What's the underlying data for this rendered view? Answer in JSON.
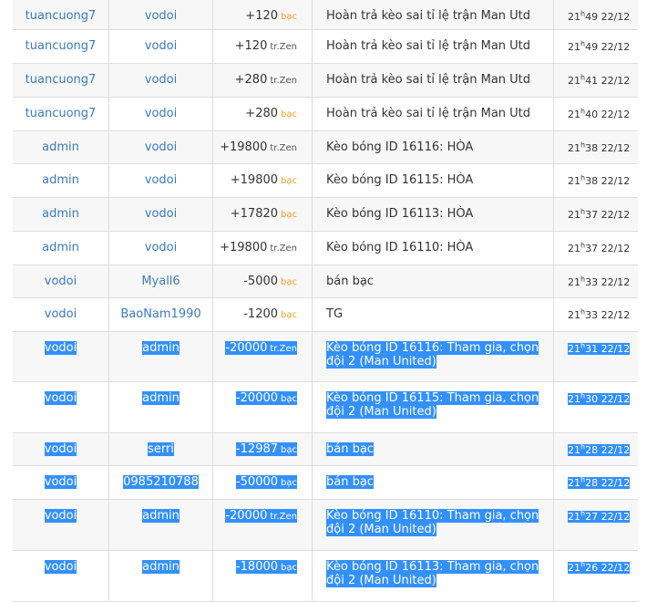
{
  "rows": [
    {
      "from": "tuancuong7",
      "to": "vodoi",
      "amount": "+120",
      "unit": "bạc",
      "note": "Hoàn trả kèo sai tỉ lệ trận Man Utd",
      "hour": "21",
      "min": "49",
      "date": "22/12",
      "selected": false
    },
    {
      "from": "tuancuong7",
      "to": "vodoi",
      "amount": "+120",
      "unit": "tr.Zen",
      "note": "Hoàn trả kèo sai tỉ lệ trận Man Utd",
      "hour": "21",
      "min": "49",
      "date": "22/12",
      "selected": false
    },
    {
      "from": "tuancuong7",
      "to": "vodoi",
      "amount": "+280",
      "unit": "tr.Zen",
      "note": "Hoàn trả kèo sai tỉ lệ trận Man Utd",
      "hour": "21",
      "min": "41",
      "date": "22/12",
      "selected": false
    },
    {
      "from": "tuancuong7",
      "to": "vodoi",
      "amount": "+280",
      "unit": "bạc",
      "note": "Hoàn trả kèo sai tỉ lệ trận Man Utd",
      "hour": "21",
      "min": "40",
      "date": "22/12",
      "selected": false
    },
    {
      "from": "admin",
      "to": "vodoi",
      "amount": "+19800",
      "unit": "tr.Zen",
      "note": "Kèo bóng ID 16116: HÒA",
      "hour": "21",
      "min": "38",
      "date": "22/12",
      "selected": false
    },
    {
      "from": "admin",
      "to": "vodoi",
      "amount": "+19800",
      "unit": "bạc",
      "note": "Kèo bóng ID 16115: HÒA",
      "hour": "21",
      "min": "38",
      "date": "22/12",
      "selected": false
    },
    {
      "from": "admin",
      "to": "vodoi",
      "amount": "+17820",
      "unit": "bạc",
      "note": "Kèo bóng ID 16113: HÒA",
      "hour": "21",
      "min": "37",
      "date": "22/12",
      "selected": false
    },
    {
      "from": "admin",
      "to": "vodoi",
      "amount": "+19800",
      "unit": "tr.Zen",
      "note": "Kèo bóng ID 16110: HÒA",
      "hour": "21",
      "min": "37",
      "date": "22/12",
      "selected": false
    },
    {
      "from": "vodoi",
      "to": "Myall6",
      "amount": "-5000",
      "unit": "bạc",
      "note": "bán bạc",
      "hour": "21",
      "min": "33",
      "date": "22/12",
      "selected": false
    },
    {
      "from": "vodoi",
      "to": "BaoNam1990",
      "amount": "-1200",
      "unit": "bạc",
      "note": "TG",
      "hour": "21",
      "min": "33",
      "date": "22/12",
      "selected": false
    },
    {
      "from": "vodoi",
      "to": "admin",
      "amount": "-20000",
      "unit": "tr.Zen",
      "note": "Kèo bóng ID 16116: Tham gia, chọn đội 2 (Man United)",
      "hour": "21",
      "min": "31",
      "date": "22/12",
      "selected": true
    },
    {
      "from": "vodoi",
      "to": "admin",
      "amount": "-20000",
      "unit": "bạc",
      "note": "Kèo bóng ID 16115: Tham gia, chọn đội 2 (Man United)",
      "hour": "21",
      "min": "30",
      "date": "22/12",
      "selected": true
    },
    {
      "from": "vodoi",
      "to": "serri",
      "amount": "-12987",
      "unit": "bạc",
      "note": "bán bạc",
      "hour": "21",
      "min": "28",
      "date": "22/12",
      "selected": true
    },
    {
      "from": "vodoi",
      "to": "0985210788",
      "amount": "-50000",
      "unit": "bạc",
      "note": "bán bạc",
      "hour": "21",
      "min": "28",
      "date": "22/12",
      "selected": true
    },
    {
      "from": "vodoi",
      "to": "admin",
      "amount": "-20000",
      "unit": "tr.Zen",
      "note": "Kèo bóng ID 16110: Tham gia, chọn đội 2 (Man United)",
      "hour": "21",
      "min": "27",
      "date": "22/12",
      "selected": true
    },
    {
      "from": "vodoi",
      "to": "admin",
      "amount": "-18000",
      "unit": "bạc",
      "note": "Kèo bóng ID 16113: Tham gia, chọn đội 2 (Man United)",
      "hour": "21",
      "min": "26",
      "date": "22/12",
      "selected": true
    }
  ]
}
